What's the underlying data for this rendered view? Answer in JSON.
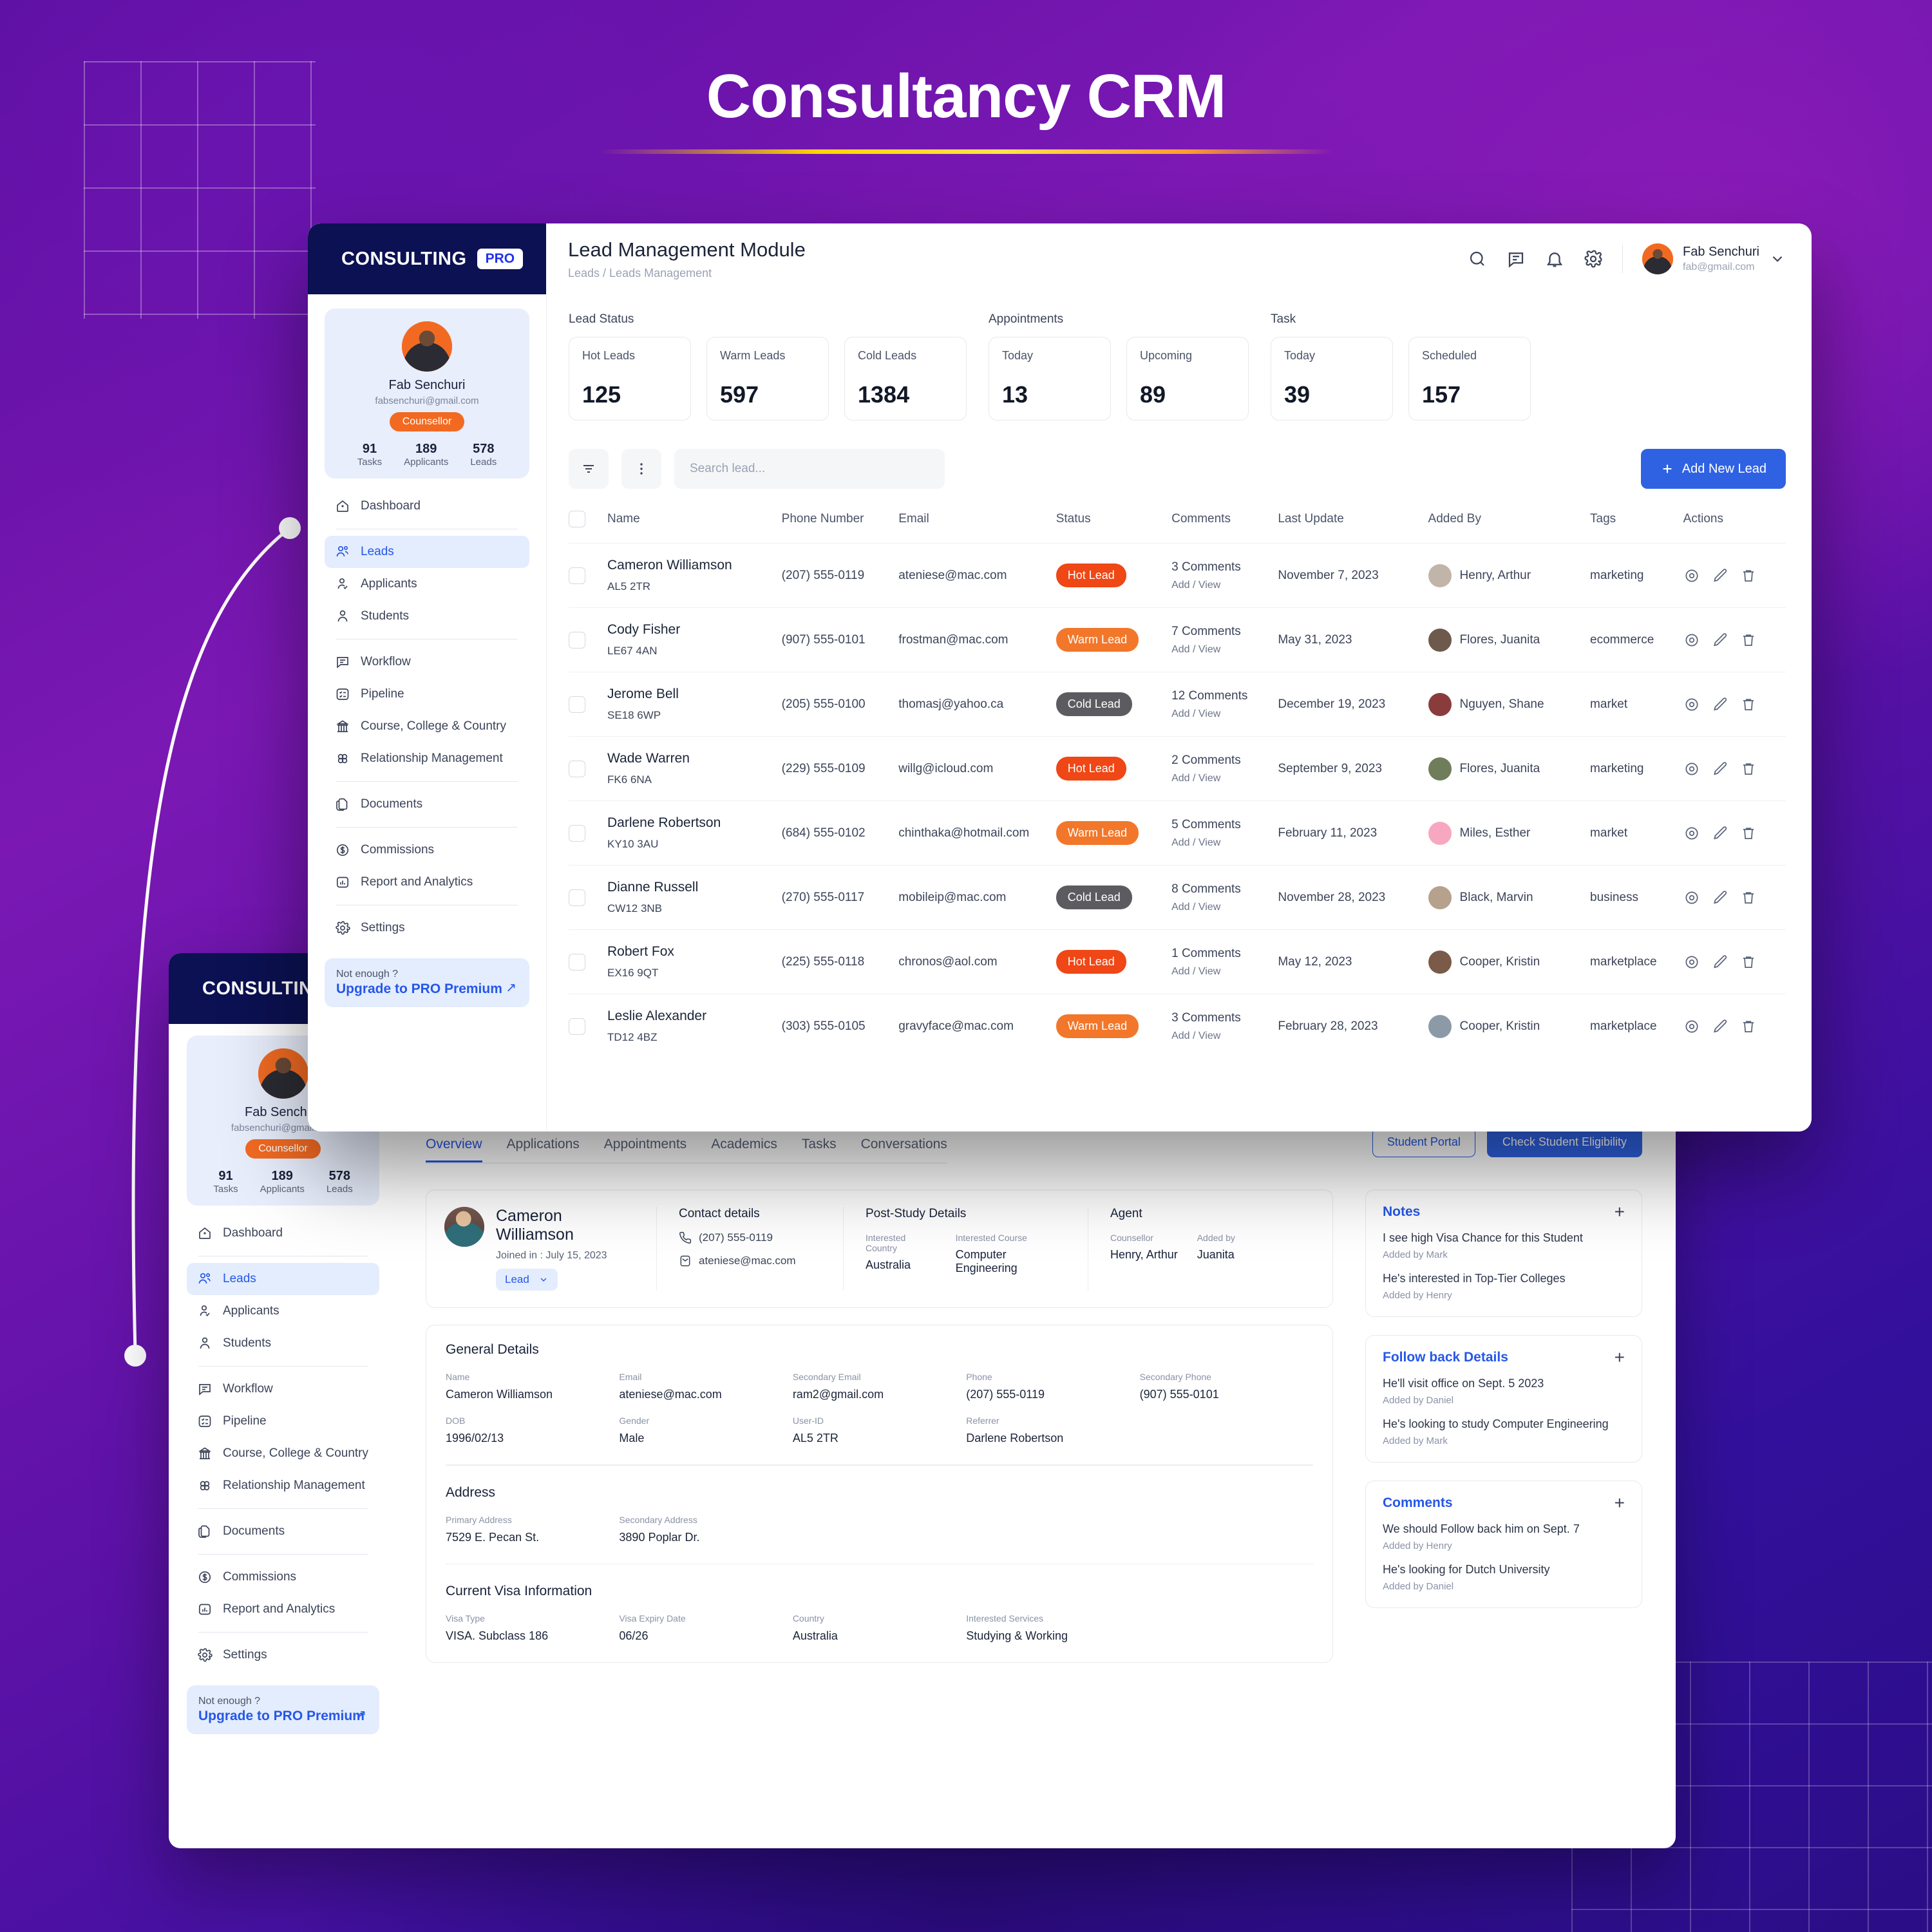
{
  "hero": {
    "title": "Consultancy CRM"
  },
  "brand": {
    "name": "CONSULTING",
    "chip": "PRO"
  },
  "header": {
    "title": "Lead Management Module",
    "breadcrumb": "Leads  /  Leads Management",
    "icons": [
      "search-icon",
      "message-icon",
      "bell-icon",
      "gear-icon"
    ],
    "user": {
      "name": "Fab Senchuri",
      "email": "fab@gmail.com"
    }
  },
  "profile": {
    "name": "Fab Senchuri",
    "email": "fabsenchuri@gmail.com",
    "role": "Counsellor",
    "stats": [
      {
        "value": "91",
        "label": "Tasks"
      },
      {
        "value": "189",
        "label": "Applicants"
      },
      {
        "value": "578",
        "label": "Leads"
      }
    ]
  },
  "sidebar": {
    "items": [
      {
        "label": "Dashboard",
        "icon": "home-icon",
        "active": false
      },
      {
        "label": "Leads",
        "icon": "users-icon",
        "active": true
      },
      {
        "label": "Applicants",
        "icon": "user-check-icon",
        "active": false
      },
      {
        "label": "Students",
        "icon": "user-icon",
        "active": false
      },
      {
        "label": "Workflow",
        "icon": "chat-icon",
        "active": false
      },
      {
        "label": "Pipeline",
        "icon": "list-icon",
        "active": false
      },
      {
        "label": "Course, College & Country",
        "icon": "bank-icon",
        "active": false
      },
      {
        "label": "Relationship Management",
        "icon": "network-icon",
        "active": false
      },
      {
        "label": "Documents",
        "icon": "documents-icon",
        "active": false
      },
      {
        "label": "Commissions",
        "icon": "dollar-icon",
        "active": false
      },
      {
        "label": "Report and Analytics",
        "icon": "chart-icon",
        "active": false
      },
      {
        "label": "Settings",
        "icon": "gear-icon",
        "active": false
      }
    ],
    "upgrade": {
      "small": "Not enough ?",
      "link": "Upgrade to PRO Premium",
      "arrow": "↗"
    }
  },
  "stat_groups": [
    {
      "label": "Lead Status",
      "cards": [
        {
          "label": "Hot Leads",
          "value": "125"
        },
        {
          "label": "Warm Leads",
          "value": "597"
        },
        {
          "label": "Cold Leads",
          "value": "1384"
        }
      ]
    },
    {
      "label": "Appointments",
      "cards": [
        {
          "label": "Today",
          "value": "13"
        },
        {
          "label": "Upcoming",
          "value": "89"
        }
      ]
    },
    {
      "label": "Task",
      "cards": [
        {
          "label": "Today",
          "value": "39"
        },
        {
          "label": "Scheduled",
          "value": "157"
        }
      ]
    }
  ],
  "toolbar": {
    "filter_icon": "filter-icon",
    "more_icon": "more-vertical-icon",
    "search_placeholder": "Search lead...",
    "search_value": "",
    "add_label": "Add New Lead"
  },
  "table": {
    "columns": [
      "Name",
      "Phone Number",
      "Email",
      "Status",
      "Comments",
      "Last Update",
      "Added By",
      "Tags",
      "Actions"
    ],
    "comments_sub": "Add / View",
    "rows": [
      {
        "name": "Cameron Williamson",
        "code": "AL5 2TR",
        "phone": "(207) 555-0119",
        "email": "ateniese@mac.com",
        "status": "Hot Lead",
        "status_type": "hot",
        "comments": "3 Comments",
        "updated": "November 7, 2023",
        "added_by": "Henry, Arthur",
        "avatar": "#c0b5a8",
        "tag": "marketing"
      },
      {
        "name": "Cody Fisher",
        "code": "LE67 4AN",
        "phone": "(907) 555-0101",
        "email": "frostman@mac.com",
        "status": "Warm Lead",
        "status_type": "warm",
        "comments": "7 Comments",
        "updated": "May 31, 2023",
        "added_by": "Flores, Juanita",
        "avatar": "#6d5a4c",
        "tag": "ecommerce"
      },
      {
        "name": "Jerome Bell",
        "code": "SE18 6WP",
        "phone": "(205) 555-0100",
        "email": "thomasj@yahoo.ca",
        "status": "Cold Lead",
        "status_type": "cold",
        "comments": "12 Comments",
        "updated": "December 19, 2023",
        "added_by": "Nguyen, Shane",
        "avatar": "#8a3c3c",
        "tag": "market"
      },
      {
        "name": "Wade Warren",
        "code": "FK6 6NA",
        "phone": "(229) 555-0109",
        "email": "willg@icloud.com",
        "status": "Hot Lead",
        "status_type": "hot",
        "comments": "2 Comments",
        "updated": "September 9, 2023",
        "added_by": "Flores, Juanita",
        "avatar": "#6f7d5a",
        "tag": "marketing"
      },
      {
        "name": "Darlene Robertson",
        "code": "KY10 3AU",
        "phone": "(684) 555-0102",
        "email": "chinthaka@hotmail.com",
        "status": "Warm Lead",
        "status_type": "warm",
        "comments": "5 Comments",
        "updated": "February 11, 2023",
        "added_by": "Miles, Esther",
        "avatar": "#f7a8c0",
        "tag": "market"
      },
      {
        "name": "Dianne Russell",
        "code": "CW12 3NB",
        "phone": "(270) 555-0117",
        "email": "mobileip@mac.com",
        "status": "Cold Lead",
        "status_type": "cold",
        "comments": "8 Comments",
        "updated": "November 28, 2023",
        "added_by": "Black, Marvin",
        "avatar": "#b5a18c",
        "tag": "business"
      },
      {
        "name": "Robert Fox",
        "code": "EX16 9QT",
        "phone": "(225) 555-0118",
        "email": "chronos@aol.com",
        "status": "Hot Lead",
        "status_type": "hot",
        "comments": "1 Comments",
        "updated": "May 12, 2023",
        "added_by": "Cooper, Kristin",
        "avatar": "#7a5a48",
        "tag": "marketplace"
      },
      {
        "name": "Leslie Alexander",
        "code": "TD12 4BZ",
        "phone": "(303) 555-0105",
        "email": "gravyface@mac.com",
        "status": "Warm Lead",
        "status_type": "warm",
        "comments": "3 Comments",
        "updated": "February 28, 2023",
        "added_by": "Cooper, Kristin",
        "avatar": "#8c9aa8",
        "tag": "marketplace"
      }
    ]
  },
  "detail": {
    "tabs": [
      {
        "label": "Overview",
        "active": true
      },
      {
        "label": "Applications",
        "active": false
      },
      {
        "label": "Appointments",
        "active": false
      },
      {
        "label": "Academics",
        "active": false
      },
      {
        "label": "Tasks",
        "active": false
      },
      {
        "label": "Conversations",
        "active": false
      }
    ],
    "actions": {
      "portal": "Student Portal",
      "eligibility": "Check Student Eligibility"
    },
    "summary": {
      "name": "Cameron Williamson",
      "joined": "Joined in : July 15, 2023",
      "status_pill": "Lead",
      "contact_title": "Contact details",
      "phone": "(207) 555-0119",
      "email": "ateniese@mac.com",
      "post_study_title": "Post-Study Details",
      "interested_country_label": "Interested Country",
      "interested_country": "Australia",
      "interested_course_label": "Interested Course",
      "interested_course": "Computer Engineering",
      "agent_title": "Agent",
      "counsellor_label": "Counsellor",
      "counsellor": "Henry, Arthur",
      "added_by_label": "Added by",
      "added_by": "Juanita"
    },
    "general": {
      "title": "General Details",
      "row1": [
        {
          "label": "Name",
          "value": "Cameron Williamson"
        },
        {
          "label": "Email",
          "value": "ateniese@mac.com"
        },
        {
          "label": "Secondary Email",
          "value": "ram2@gmail.com"
        },
        {
          "label": "Phone",
          "value": "(207) 555-0119"
        },
        {
          "label": "Secondary Phone",
          "value": "(907) 555-0101"
        }
      ],
      "row2": [
        {
          "label": "DOB",
          "value": "1996/02/13"
        },
        {
          "label": "Gender",
          "value": "Male"
        },
        {
          "label": "User-ID",
          "value": "AL5 2TR"
        },
        {
          "label": "Referrer",
          "value": "Darlene Robertson"
        },
        {
          "label": "",
          "value": ""
        }
      ]
    },
    "address": {
      "title": "Address",
      "fields": [
        {
          "label": "Primary Address",
          "value": "7529 E. Pecan St."
        },
        {
          "label": "Secondary Address",
          "value": "3890 Poplar Dr."
        }
      ]
    },
    "visa": {
      "title": "Current Visa Information",
      "fields": [
        {
          "label": "Visa Type",
          "value": "VISA. Subclass 186"
        },
        {
          "label": "Visa Expiry Date",
          "value": "06/26"
        },
        {
          "label": "Country",
          "value": "Australia"
        },
        {
          "label": "Interested Services",
          "value": "Studying & Working"
        }
      ]
    },
    "side_cards": [
      {
        "title": "Notes",
        "items": [
          {
            "text": "I see high Visa Chance for this Student",
            "by": "Added by Mark"
          },
          {
            "text": "He's interested in Top-Tier Colleges",
            "by": "Added by Henry"
          }
        ]
      },
      {
        "title": "Follow back Details",
        "items": [
          {
            "text": "He'll visit office on Sept. 5 2023",
            "by": "Added by Daniel"
          },
          {
            "text": "He's looking to study Computer Engineering",
            "by": "Added by Mark"
          }
        ]
      },
      {
        "title": "Comments",
        "items": [
          {
            "text": "We should Follow back him on Sept. 7",
            "by": "Added by Henry"
          },
          {
            "text": "He's looking for Dutch University",
            "by": "Added by Daniel"
          }
        ]
      }
    ]
  },
  "colors": {
    "accent_blue": "#2557e8",
    "hot": "#ef4715",
    "warm": "#f2772a",
    "cold": "#5c5c60",
    "orange": "#f26a22",
    "navy": "#0b1152"
  }
}
